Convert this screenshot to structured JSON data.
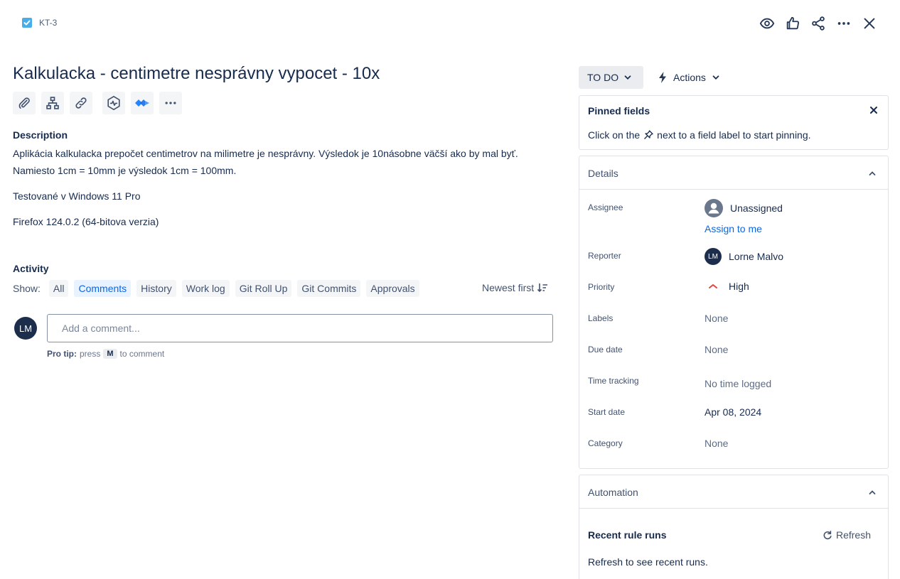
{
  "issue": {
    "key": "KT-3",
    "title": "Kalkulacka - centimetre nesprávny vypocet - 10x"
  },
  "description": {
    "label": "Description",
    "lines": [
      "Aplikácia kalkulacka prepočet centimetrov na milimetre je nesprávny. Výsledok je 10násobne väčší ako by mal byť.",
      "Namiesto 1cm = 10mm je výsledok 1cm = 100mm.",
      "Testované v Windows 11 Pro",
      "Firefox 124.0.2 (64-bitova verzia)"
    ]
  },
  "activity": {
    "label": "Activity",
    "show_label": "Show:",
    "filters": [
      "All",
      "Comments",
      "History",
      "Work log",
      "Git Roll Up",
      "Git Commits",
      "Approvals"
    ],
    "active_filter": "Comments",
    "sort_label": "Newest first",
    "comment_placeholder": "Add a comment...",
    "user_initials": "LM",
    "protip_prefix": "Pro tip:",
    "protip_press": "press",
    "protip_key": "M",
    "protip_suffix": "to comment"
  },
  "status": {
    "label": "TO DO",
    "actions_label": "Actions"
  },
  "pinned": {
    "title": "Pinned fields",
    "text_before": "Click on the",
    "text_after": "next to a field label to start pinning."
  },
  "details": {
    "title": "Details",
    "assignee_label": "Assignee",
    "assignee_value": "Unassigned",
    "assign_to_me": "Assign to me",
    "reporter_label": "Reporter",
    "reporter_initials": "LM",
    "reporter_value": "Lorne Malvo",
    "priority_label": "Priority",
    "priority_value": "High",
    "labels_label": "Labels",
    "labels_value": "None",
    "due_label": "Due date",
    "due_value": "None",
    "time_label": "Time tracking",
    "time_value": "No time logged",
    "start_label": "Start date",
    "start_value": "Apr 08, 2024",
    "category_label": "Category",
    "category_value": "None"
  },
  "automation": {
    "title": "Automation",
    "recent_title": "Recent rule runs",
    "refresh_label": "Refresh",
    "recent_text": "Refresh to see recent runs."
  },
  "colors": {
    "accent": "#0c66e4",
    "text": "#172b4d",
    "priority_high": "#e2483d",
    "checkbox": "#4bade8"
  }
}
